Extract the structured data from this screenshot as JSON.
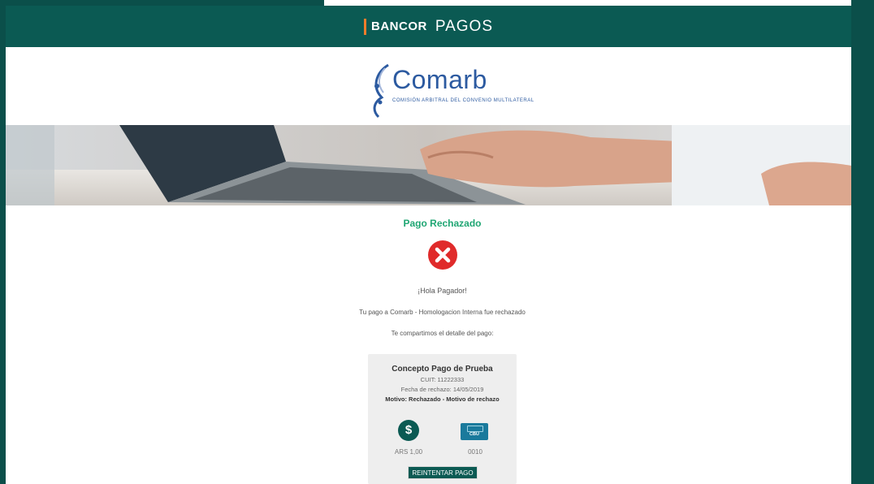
{
  "header": {
    "brand_bold": "BANCOR",
    "brand_light": "PAGOS"
  },
  "merchant": {
    "name": "Comarb",
    "subtitle": "COMISIÓN ARBITRAL DEL CONVENIO MULTILATERAL"
  },
  "status": {
    "title": "Pago Rechazado",
    "icon": "close-circle-icon",
    "color": "#1fa673",
    "icon_color": "#e02b2b"
  },
  "body": {
    "greeting": "¡Hola Pagador!",
    "message": "Tu pago a Comarb - Homologacion Interna fue rechazado",
    "share": "Te compartimos el detalle del pago:"
  },
  "card": {
    "title": "Concepto Pago de Prueba",
    "cuit": "CUIT: 11222333",
    "date": "Fecha de rechazo: 14/05/2019",
    "reason": "Motivo: Rechazado - Motivo de rechazo",
    "amount": "ARS 1,00",
    "account": "0010",
    "account_icon_label": "CBU",
    "money_icon_symbol": "$",
    "retry_label": "REINTENTAR PAGO"
  },
  "colors": {
    "brand_dark": "#0b5a53",
    "accent_orange": "#f07d2b"
  }
}
